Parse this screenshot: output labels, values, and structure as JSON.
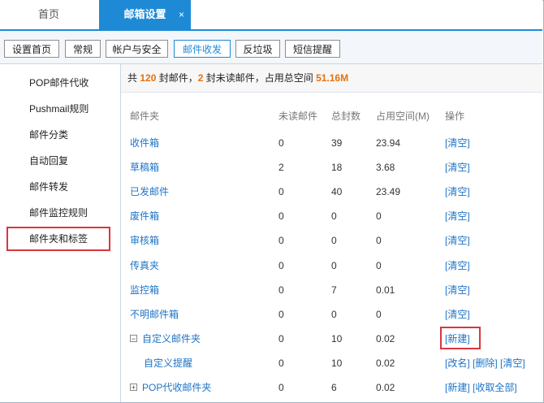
{
  "tabs": {
    "home": "首页",
    "active": "邮箱设置",
    "close": "×"
  },
  "toolbar": [
    "设置首页",
    "常规",
    "帐户与安全",
    "邮件收发",
    "反垃圾",
    "短信提醒"
  ],
  "sidebar": [
    "POP邮件代收",
    "Pushmail规则",
    "邮件分类",
    "自动回复",
    "邮件转发",
    "邮件监控规则",
    "邮件夹和标签"
  ],
  "summary": {
    "p1": "共 ",
    "total": "120",
    "p2": " 封邮件，",
    "unread": "2",
    "p3": " 封未读邮件，占用总空间 ",
    "size": "51.16M"
  },
  "headers": {
    "folder": "邮件夹",
    "unread": "未读邮件",
    "total": "总封数",
    "space": "占用空间(M)",
    "ops": "操作"
  },
  "rows": [
    {
      "name": "收件箱",
      "unread": "0",
      "total": "39",
      "space": "23.94",
      "ops": "[清空]"
    },
    {
      "name": "草稿箱",
      "unread": "2",
      "total": "18",
      "space": "3.68",
      "ops": "[清空]"
    },
    {
      "name": "已发邮件",
      "unread": "0",
      "total": "40",
      "space": "23.49",
      "ops": "[清空]"
    },
    {
      "name": "废件箱",
      "unread": "0",
      "total": "0",
      "space": "0",
      "ops": "[清空]"
    },
    {
      "name": "审核箱",
      "unread": "0",
      "total": "0",
      "space": "0",
      "ops": "[清空]"
    },
    {
      "name": "传真夹",
      "unread": "0",
      "total": "0",
      "space": "0",
      "ops": "[清空]"
    },
    {
      "name": "监控箱",
      "unread": "0",
      "total": "7",
      "space": "0.01",
      "ops": "[清空]"
    },
    {
      "name": "不明邮件箱",
      "unread": "0",
      "total": "0",
      "space": "0",
      "ops": "[清空]"
    },
    {
      "name": "自定义邮件夹",
      "expander": "⊟",
      "unread": "0",
      "total": "10",
      "space": "0.02",
      "ops": "[新建]"
    },
    {
      "name": "自定义提醒",
      "unread": "0",
      "total": "10",
      "space": "0.02",
      "ops": "[改名] [删除] [清空]"
    },
    {
      "name": "POP代收邮件夹",
      "expander": "⊞",
      "unread": "0",
      "total": "6",
      "space": "0.02",
      "ops": "[新建] [收取全部]"
    }
  ]
}
